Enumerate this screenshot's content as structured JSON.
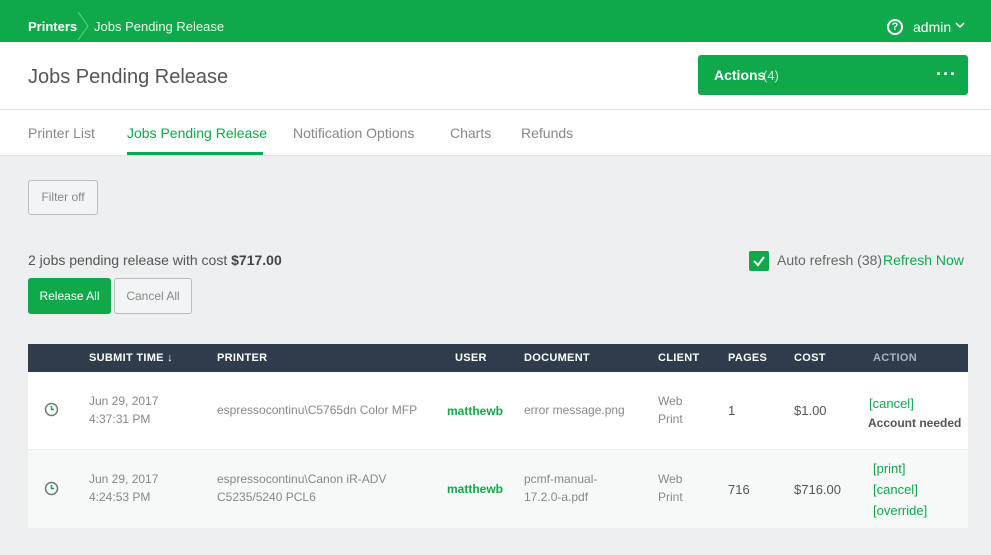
{
  "breadcrumb": {
    "root": "Printers",
    "current": "Jobs Pending Release"
  },
  "user_menu": {
    "name": "admin",
    "help_icon": "question-circle-icon",
    "chevron_icon": "chevron-down-icon"
  },
  "page": {
    "title": "Jobs Pending Release"
  },
  "actions": {
    "label": "Actions",
    "count": "(4)",
    "menu_icon": "more-dots-icon"
  },
  "tabs": [
    {
      "label": "Printer List"
    },
    {
      "label": "Jobs Pending Release"
    },
    {
      "label": "Notification Options"
    },
    {
      "label": "Charts"
    },
    {
      "label": "Refunds"
    }
  ],
  "filter": {
    "label": "Filter off"
  },
  "summary": {
    "text": "2 jobs pending release with cost",
    "cost": "$717.00"
  },
  "auto_refresh": {
    "checked": true,
    "label": "Auto refresh (38)",
    "refresh_now": "Refresh Now"
  },
  "buttons": {
    "release_all": "Release All",
    "cancel_all": "Cancel All"
  },
  "table": {
    "headers": {
      "submit_time": "SUBMIT TIME ↓",
      "printer": "PRINTER",
      "user": "USER",
      "document": "DOCUMENT",
      "client": "CLIENT",
      "pages": "PAGES",
      "cost": "COST",
      "action": "ACTION"
    },
    "rows": [
      {
        "date": "Jun 29, 2017",
        "time": "4:37:31 PM",
        "printer_line1": "espressocontinu\\C5765dn Color MFP",
        "printer_line2": "",
        "user": "matthewb",
        "document_line1": "error message.png",
        "document_line2": "",
        "client_line1": "Web",
        "client_line2": "Print",
        "pages": "1",
        "cost": "$1.00",
        "actions": [
          "[cancel]"
        ],
        "note": "Account needed"
      },
      {
        "date": "Jun 29, 2017",
        "time": "4:24:53 PM",
        "printer_line1": "espressocontinu\\Canon iR-ADV",
        "printer_line2": "C5235/5240 PCL6",
        "user": "matthewb",
        "document_line1": "pcmf-manual-",
        "document_line2": "17.2.0-a.pdf",
        "client_line1": "Web",
        "client_line2": "Print",
        "pages": "716",
        "cost": "$716.00",
        "actions": [
          "[print]",
          "[cancel]",
          "[override]"
        ],
        "note": ""
      }
    ]
  },
  "colors": {
    "brand_green": "#0fa94b",
    "table_header": "#2e3c4b",
    "background": "#edeff0"
  }
}
